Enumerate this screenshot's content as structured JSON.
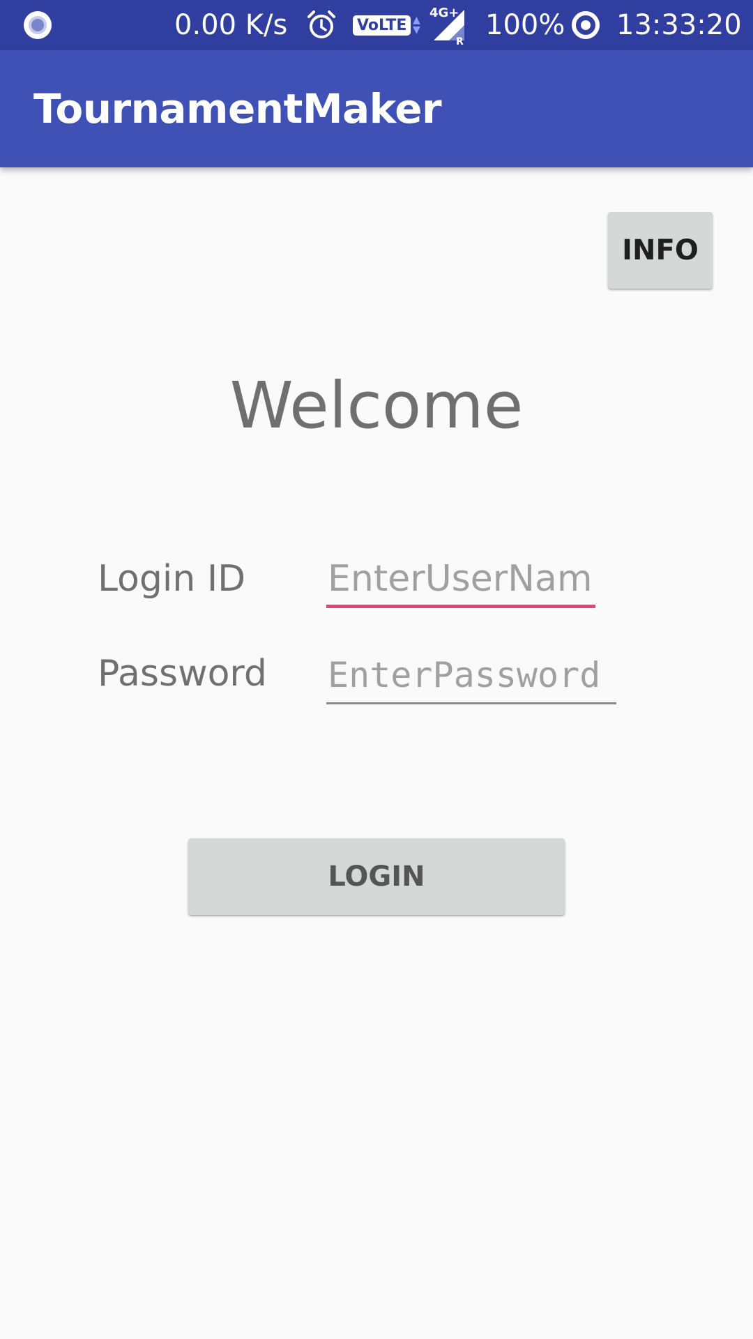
{
  "status_bar": {
    "network_speed": "0.00 K/s",
    "volte_label": "VoLTE",
    "network_type": "4G+",
    "roaming_indicator": "R",
    "battery": "100%",
    "time": "13:33:20",
    "icons": [
      "screen-record-icon",
      "alarm-icon",
      "volte-icon",
      "data-arrows-icon",
      "signal-icon",
      "data-saver-icon"
    ]
  },
  "app_bar": {
    "title": "TournamentMaker",
    "color": "#3f51b5"
  },
  "info_button": {
    "label": "INFO"
  },
  "welcome": {
    "text": "Welcome"
  },
  "form": {
    "login_label": "Login ID",
    "username_placeholder": "EnterUserName",
    "username_value": "",
    "password_label": "Password",
    "password_placeholder": "EnterPassword",
    "password_value": "",
    "focus_accent": "#ec407a"
  },
  "login_button": {
    "label": "LOGIN"
  }
}
